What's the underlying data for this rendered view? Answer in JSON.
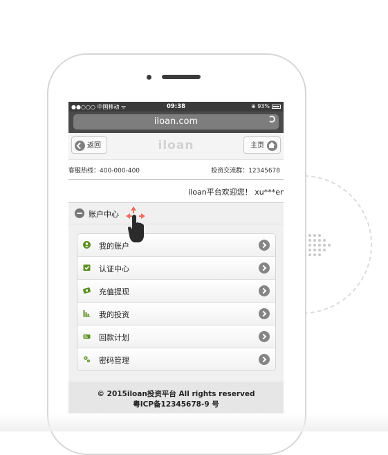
{
  "status_bar": {
    "carrier": "●●○○○ 中国移动 ᯤ",
    "time": "09:38",
    "battery": "⊕ 93%"
  },
  "browser": {
    "url": "iloan.com"
  },
  "header": {
    "back_label": "返回",
    "logo": "iloan",
    "home_label": "主页"
  },
  "info": {
    "hotline": "客服热线：400-000-400",
    "group": "投资交流群：12345678"
  },
  "welcome": "iloan平台欢迎您！ xu***en",
  "panel": {
    "title": "账户中心"
  },
  "menu": [
    {
      "label": "我的账户",
      "icon": "user-icon"
    },
    {
      "label": "认证中心",
      "icon": "verify-icon"
    },
    {
      "label": "充值提现",
      "icon": "recharge-icon"
    },
    {
      "label": "我的投资",
      "icon": "investment-chart-icon"
    },
    {
      "label": "回款计划",
      "icon": "repayment-plan-icon"
    },
    {
      "label": "密码管理",
      "icon": "password-gear-icon"
    }
  ],
  "footer": {
    "line1": "©  2015iloan投资平台 All rights reserved",
    "line2": "粤ICP备12345678-9 号"
  },
  "colors": {
    "accent_green": "#5a8f1e",
    "status_bar": "#3b3b3b",
    "url_bar": "#7d7d7d"
  }
}
